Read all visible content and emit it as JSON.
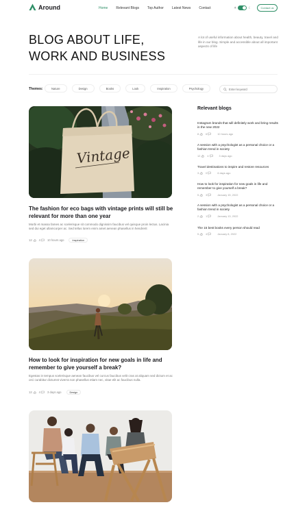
{
  "header": {
    "logo_text": "Around",
    "nav": [
      "Home",
      "Relevant Blogs",
      "Top Author",
      "Latest News",
      "Contact"
    ],
    "contact_button": "Contact us"
  },
  "hero": {
    "title_line1": "BLOG ABOUT LIFE,",
    "title_line2": "WORK AND BUSINESS",
    "description": "A lot of useful information about health, beauty, travel and life in our blog. Simple and accessible about all important aspects of life"
  },
  "themes": {
    "label": "Themes:",
    "chips": [
      "Nature",
      "Design",
      "Books",
      "Look",
      "Inspiration",
      "Psychology"
    ],
    "search_placeholder": "Enter keyword"
  },
  "posts": [
    {
      "title": "The fashion for eco bags with vintage prints will still be relevant for more than one year",
      "excerpt": "Morbi et massa fames ac scelerisque sit commodo dignissim faucibus vel quisque proin lectus. Lacinia sed dui eget ullamcorper ac. Sed tellus lorem enim amet aenean phasellus in hendrerit",
      "likes": "12",
      "comments": "4",
      "time": "10 hours ago",
      "tag": "Inspiration",
      "bag_text": "Vintage"
    },
    {
      "title": "How to look for inspiration for new goals in life and remember to give yourself a break?",
      "excerpt": "Egestas in tempus scelerisque aenean faucibus vel curcus faucibus velit cras at aliquam sed dictum et ac orci curabitur dictumst viverra non phasellus etiam nec, vitae elit ac faucibus nulla.",
      "likes": "12",
      "comments": "4",
      "time": "3 days ago",
      "tag": "Design"
    }
  ],
  "sidebar": {
    "title": "Relevant blogs",
    "items": [
      {
        "title": "Instagram brands that will definitely work and bring results in the new 2022",
        "likes": "8",
        "comments": "6",
        "date": "10 hours ago"
      },
      {
        "title": "A session with a psychologist as a personal choice or a fashion trend in society",
        "likes": "12",
        "comments": "4",
        "date": "3 days ago"
      },
      {
        "title": "Travel destinations to inspire and restore resources",
        "likes": "3",
        "comments": "0",
        "date": "6 days ago"
      },
      {
        "title": "How to look for inspiration for new goals in life and remember to give yourself a break?",
        "likes": "5",
        "comments": "3",
        "date": "January 15, 2022"
      },
      {
        "title": "A session with a psychologist as a personal choice or a fashion trend in society",
        "likes": "2",
        "comments": "1",
        "date": "January 13, 2022"
      },
      {
        "title": "The 15 best books every person should read",
        "likes": "5",
        "comments": "4",
        "date": "January 8, 2022"
      }
    ]
  },
  "colors": {
    "accent": "#2f8f67",
    "text": "#1b1b1f",
    "muted": "#777777"
  }
}
